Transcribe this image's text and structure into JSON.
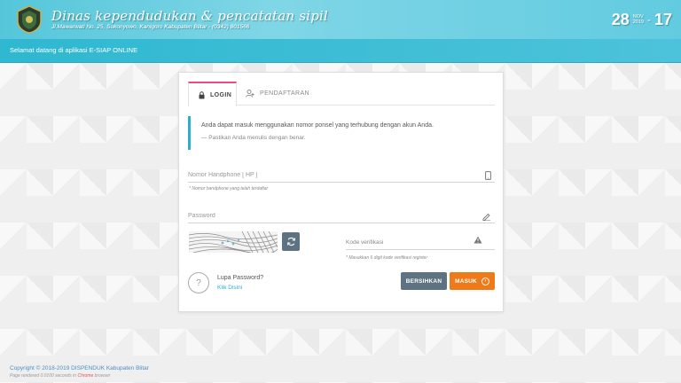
{
  "header": {
    "org_title": "Dinas kependudukan & pencatatan sipil",
    "org_address": "Jl.Mawarwati No. 25, Sukonyowo, Kanigoro Kabupaten Blitar - (0342) 801566",
    "clock": {
      "day": "28",
      "month_label": "NOV",
      "year_label": "2019",
      "separator": "-",
      "hour": "17"
    }
  },
  "welcome": {
    "text": "Selamat datang di aplikasi E-SIAP ONLINE"
  },
  "tabs": [
    {
      "label": "LOGIN",
      "icon": "lock-icon",
      "active": true
    },
    {
      "label": "PENDAFTARAN",
      "icon": "user-add-icon",
      "active": false
    }
  ],
  "info": {
    "line1": "Anda dapat masuk menggunakan nomor ponsel yang terhubung dengan akun Anda.",
    "line2": "— Pastikan Anda menulis dengan benar."
  },
  "form": {
    "phone": {
      "placeholder": "Nomor Handphone [ HP ]",
      "value": "",
      "hint": "* Nomor handphone yang telah terdaftar",
      "icon": "mobile-phone-icon"
    },
    "password": {
      "placeholder": "Password",
      "value": "",
      "icon": "pencil-icon"
    },
    "captcha": {
      "image_text": "",
      "refresh_icon": "refresh-icon"
    },
    "kode": {
      "placeholder": "Kode verifikasi",
      "value": "",
      "hint": "* Masukkan 6 digit kode verifikasi register",
      "icon": "warning-icon"
    }
  },
  "forgot": {
    "title": "Lupa Password?",
    "link": "Klik Disini",
    "icon": "question-icon",
    "icon_glyph": "?"
  },
  "buttons": {
    "clear": "BERSIHKAN",
    "login": "MASUK",
    "login_icon": "arrow-right-circle-icon",
    "login_arrow_glyph": "›"
  },
  "footer": {
    "copyright": "Copyright © 2018-2019 DISPENDUK Kabupaten Blitar",
    "render_prefix": "Page rendered 0.0100 seconds in",
    "render_browser": "Chrome",
    "render_suffix": "browser"
  },
  "colors": {
    "header": "#62cbe0",
    "welcome_bar": "#2fb8d1",
    "accent_pink": "#e84b85",
    "accent_blue": "#2aaed0",
    "button_gray": "#5e7381",
    "button_orange": "#ef7a19"
  }
}
